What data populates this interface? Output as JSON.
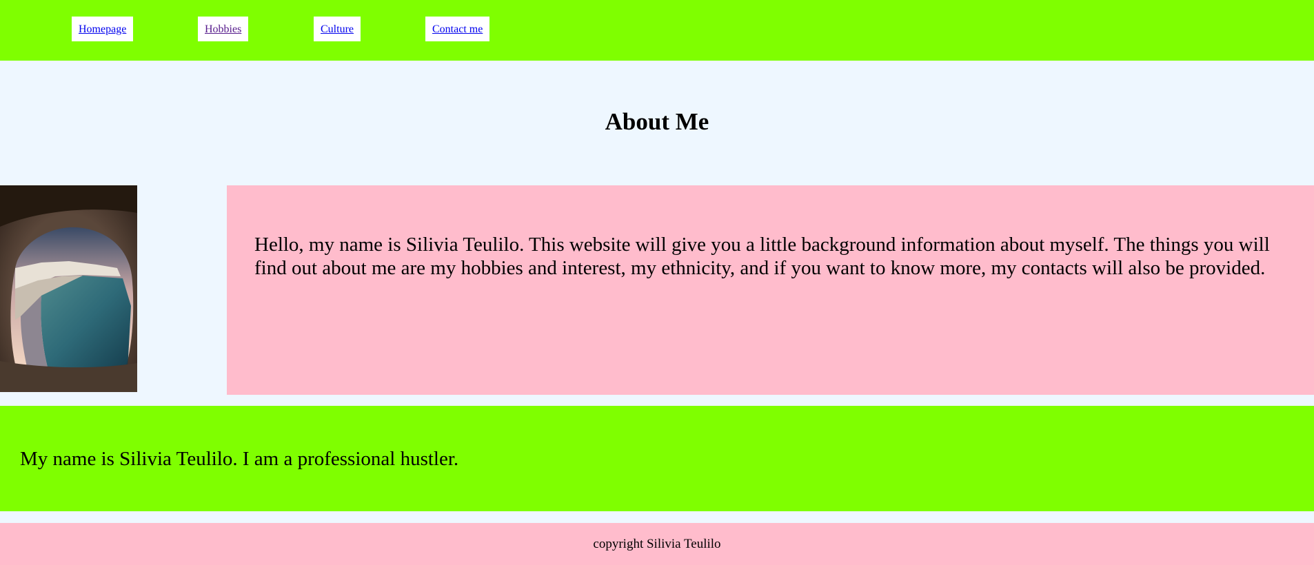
{
  "nav": {
    "items": [
      {
        "label": "Homepage"
      },
      {
        "label": "Hobbies"
      },
      {
        "label": "Culture"
      },
      {
        "label": "Contact me"
      }
    ]
  },
  "main": {
    "title": "About Me",
    "intro": "Hello, my name is Silivia Teulilo. This website will give you a little background information about myself. The things you will find out about me are my hobbies and interest, my ethnicity, and if you want to know more, my contacts will also be provided.",
    "bio": "My name is Silivia Teulilo. I am a professional hustler.",
    "photo_icon": "cave-ocean-cliff-photo"
  },
  "footer": {
    "copyright": "copyright Silivia Teulilo"
  },
  "colors": {
    "nav_bg": "#7fff00",
    "page_bg": "#eef7ff",
    "intro_bg": "#ffbccc",
    "bio_bg": "#7fff00",
    "footer_bg": "#ffbccc",
    "link": "#0000ee",
    "link_visited": "#551a8b"
  }
}
